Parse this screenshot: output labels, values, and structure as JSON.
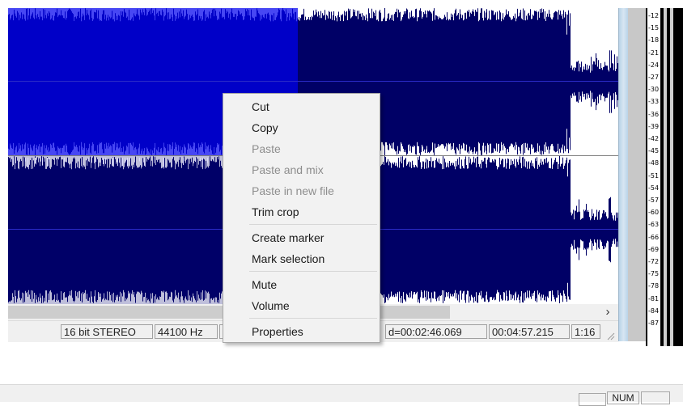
{
  "waveform": {
    "selection_color": "#0000ee",
    "wave_color": "#000066",
    "peak_color": "#2a2ac8"
  },
  "scrollbar": {
    "right_arrow": "›"
  },
  "status_fields": {
    "bit_depth": "16 bit STEREO",
    "sample_rate": "44100 Hz",
    "duration": "d=00:02:46.069",
    "length": "00:04:57.215",
    "zoom": "1:16"
  },
  "meter_scale": [
    "-12",
    "-15",
    "-18",
    "-21",
    "-24",
    "-27",
    "-30",
    "-33",
    "-36",
    "-39",
    "-42",
    "-45",
    "-48",
    "-51",
    "-54",
    "-57",
    "-60",
    "-63",
    "-66",
    "-69",
    "-72",
    "-75",
    "-78",
    "-81",
    "-84",
    "-87"
  ],
  "context_menu": {
    "items": [
      {
        "label": "Cut",
        "enabled": true
      },
      {
        "label": "Copy",
        "enabled": true
      },
      {
        "label": "Paste",
        "enabled": false
      },
      {
        "label": "Paste and mix",
        "enabled": false
      },
      {
        "label": "Paste in new file",
        "enabled": false
      },
      {
        "label": "Trim crop",
        "enabled": true
      },
      {
        "label": "Create marker",
        "enabled": true
      },
      {
        "label": "Mark selection",
        "enabled": true
      },
      {
        "label": "Mute",
        "enabled": true
      },
      {
        "label": "Volume",
        "enabled": true
      },
      {
        "label": "Properties",
        "enabled": true
      }
    ]
  },
  "app_status": {
    "num_lock": "NUM"
  }
}
